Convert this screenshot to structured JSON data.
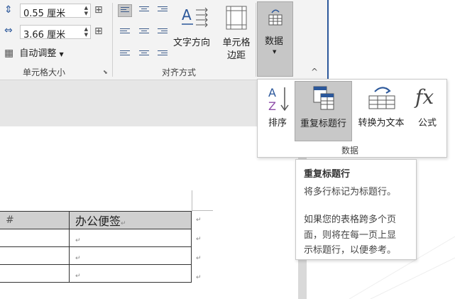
{
  "cell_size": {
    "row_height": "0.55 厘米",
    "col_width": "3.66 厘米",
    "autofit_label": "自动调整",
    "group_label": "单元格大小"
  },
  "alignment": {
    "text_direction_label": "文字方向",
    "cell_margin_label_line1": "单元格",
    "cell_margin_label_line2": "边距",
    "group_label": "对齐方式"
  },
  "data_button": {
    "label": "数据"
  },
  "data_panel": {
    "items": [
      {
        "label": "排序"
      },
      {
        "label": "重复标题行"
      },
      {
        "label": "转换为文本"
      },
      {
        "label": "公式"
      }
    ],
    "group_label": "数据"
  },
  "tooltip": {
    "title": "重复标题行",
    "desc": "将多行标记为标题行。",
    "detail_line1": "如果您的表格跨多个页",
    "detail_line2": "面，则将在每一页上显",
    "detail_line3": "示标题行，以便参考。"
  },
  "document": {
    "header_left": "#",
    "header_right": "办公便签",
    "cell_mark": "↵"
  },
  "colors": {
    "accent": "#2b579a",
    "selected": "#c8c8c8"
  }
}
